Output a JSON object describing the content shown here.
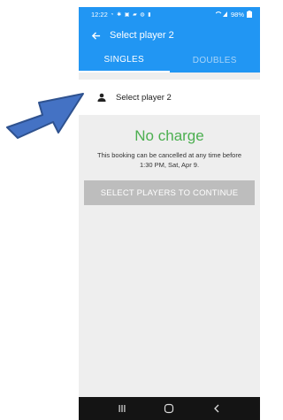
{
  "status_bar": {
    "time": "12:22",
    "battery": "98%"
  },
  "app_bar": {
    "title": "Select player 2"
  },
  "tabs": [
    {
      "label": "SINGLES",
      "active": true
    },
    {
      "label": "DOUBLES",
      "active": false
    }
  ],
  "player_row": {
    "label": "Select player 2"
  },
  "charge": {
    "title": "No charge",
    "note": "This booking can be cancelled at any time before 1:30 PM, Sat, Apr 9."
  },
  "continue_button": {
    "label": "SELECT PLAYERS TO CONTINUE"
  },
  "colors": {
    "primary": "#2196f3",
    "charge_green": "#4caf50",
    "disabled_button": "#bdbdbd",
    "annotation_arrow": "#4472c4"
  },
  "icons": [
    "back-arrow-icon",
    "person-icon",
    "recent-apps-icon",
    "home-icon",
    "back-icon",
    "annotation-arrow"
  ]
}
